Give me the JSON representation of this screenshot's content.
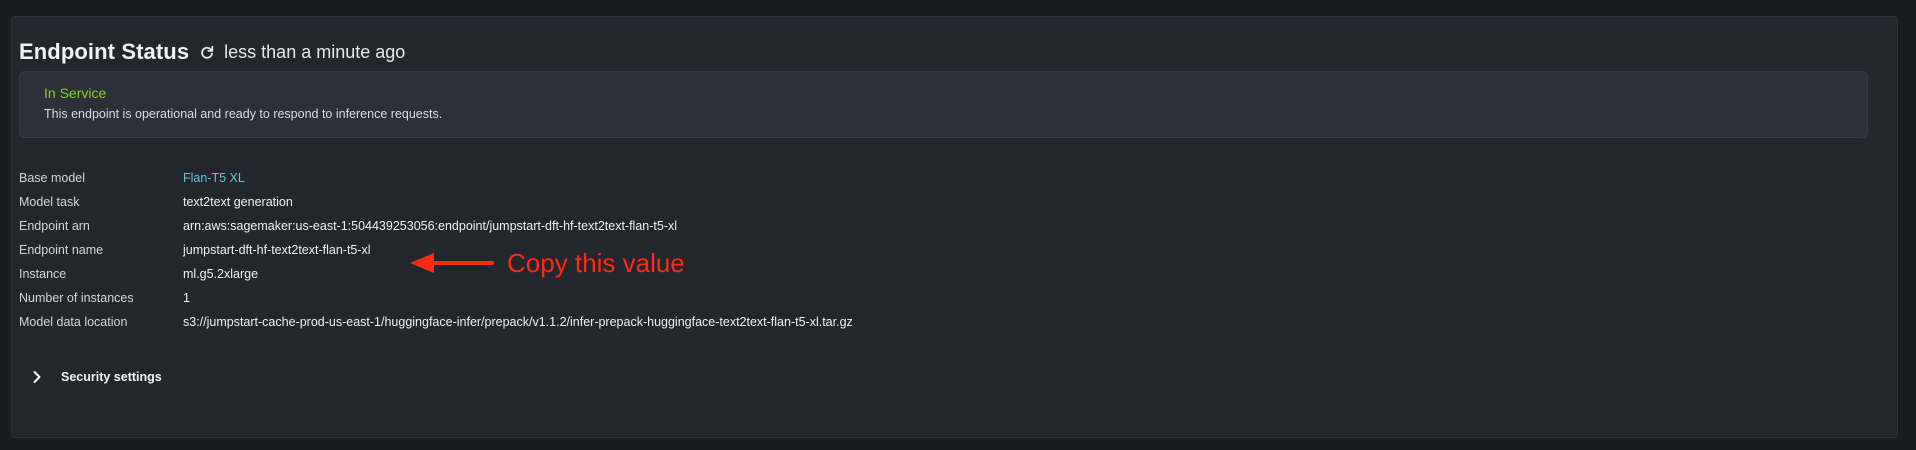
{
  "header": {
    "title": "Endpoint Status",
    "refresh_icon": "refresh-icon",
    "updated": "less than a minute ago"
  },
  "status": {
    "title": "In Service",
    "description": "This endpoint is operational and ready to respond to inference requests.",
    "color": "#7ed321"
  },
  "details": [
    {
      "label": "Base model",
      "value": "Flan-T5 XL"
    },
    {
      "label": "Model task",
      "value": "text2text generation"
    },
    {
      "label": "Endpoint arn",
      "value": "arn:aws:sagemaker:us-east-1:504439253056:endpoint/jumpstart-dft-hf-text2text-flan-t5-xl"
    },
    {
      "label": "Endpoint name",
      "value": "jumpstart-dft-hf-text2text-flan-t5-xl"
    },
    {
      "label": "Instance",
      "value": "ml.g5.2xlarge"
    },
    {
      "label": "Number of instances",
      "value": "1"
    },
    {
      "label": "Model data location",
      "value": "s3://jumpstart-cache-prod-us-east-1/huggingface-infer/prepack/v1.1.2/infer-prepack-huggingface-text2text-flan-t5-xl.tar.gz"
    }
  ],
  "annotation": {
    "text": "Copy this value",
    "color": "#ff2a12"
  },
  "security": {
    "label": "Security settings",
    "icon": "chevron-right-icon"
  },
  "colors": {
    "background": "#1b1c22",
    "panel": "#24262e",
    "link": "#5fc6d6"
  }
}
